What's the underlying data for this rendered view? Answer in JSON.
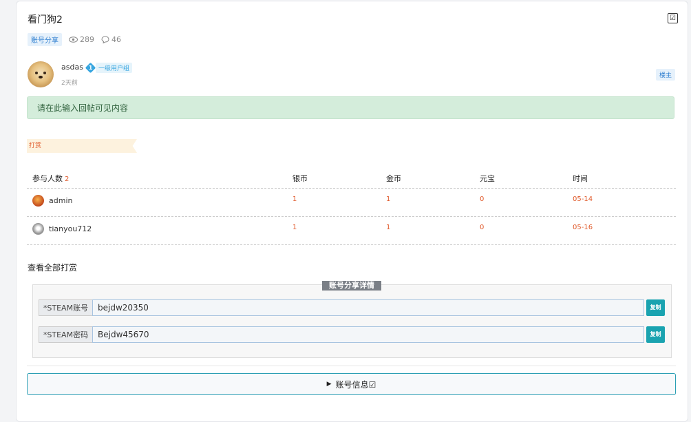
{
  "post": {
    "title": "看门狗2",
    "category_tag": "账号分享",
    "views": "289",
    "comments": "46",
    "checkbox_glyph": "☑"
  },
  "author": {
    "name": "asdas",
    "level_number": "1",
    "level_name": "一级用户组",
    "time": "2天前",
    "owner_badge": "楼主"
  },
  "notice": "请在此输入回帖可见内容",
  "reward": {
    "ribbon_label": "打赏",
    "headers": {
      "participants": "参与人数",
      "participants_count": "2",
      "silver": "银币",
      "gold": "金币",
      "yuanbao": "元宝",
      "time": "时间"
    },
    "rows": [
      {
        "user": "admin",
        "silver": "1",
        "gold": "1",
        "yuanbao": "0",
        "time": "05-14"
      },
      {
        "user": "tianyou712",
        "silver": "1",
        "gold": "1",
        "yuanbao": "0",
        "time": "05-16"
      }
    ],
    "view_all": "查看全部打赏"
  },
  "account_share": {
    "legend": "账号分享详情",
    "fields": [
      {
        "label": "*STEAM账号",
        "value": "bejdw20350",
        "copy_label": "复制"
      },
      {
        "label": "*STEAM密码",
        "value": "Bejdw45670",
        "copy_label": "复制"
      }
    ]
  },
  "details_toggle": {
    "triangle": "▶",
    "label": "账号信息☑"
  },
  "colors": {
    "accent": "#2f7fd0",
    "red_value": "#e05a2b",
    "success_bg": "#d4eddb",
    "copy_button": "#1aa3b0"
  }
}
